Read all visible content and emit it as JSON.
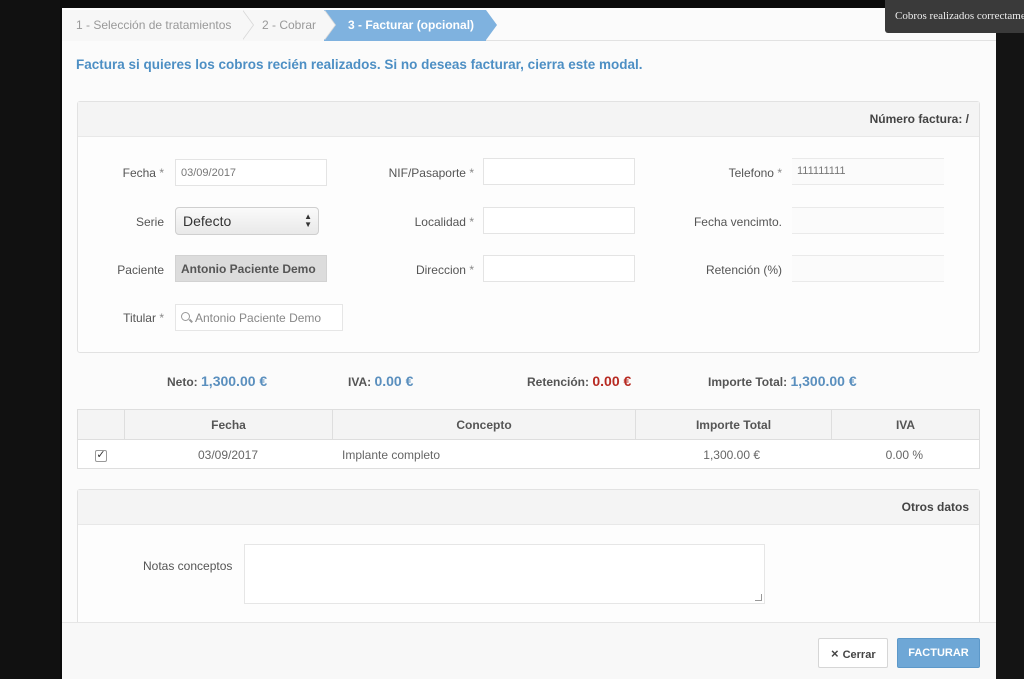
{
  "wizard": {
    "steps": [
      {
        "label": "1 - Selección de tratamientos"
      },
      {
        "label": "2 - Cobrar"
      },
      {
        "label": "3 - Facturar (opcional)"
      }
    ]
  },
  "toast": {
    "text": "Cobros realizados correctamente"
  },
  "intro": "Factura si quieres los cobros recién realizados. Si no deseas facturar, cierra este modal.",
  "invoice": {
    "header": "Número factura: /",
    "fields": {
      "fecha": {
        "label": "Fecha",
        "value": "03/09/2017"
      },
      "serie": {
        "label": "Serie",
        "value": "Defecto"
      },
      "paciente": {
        "label": "Paciente",
        "value": "Antonio Paciente Demo"
      },
      "titular": {
        "label": "Titular",
        "placeholder": "Antonio Paciente Demo"
      },
      "nif": {
        "label": "NIF/Pasaporte",
        "value": ""
      },
      "localidad": {
        "label": "Localidad",
        "value": ""
      },
      "direccion": {
        "label": "Direccion",
        "value": ""
      },
      "telefono": {
        "label": "Telefono",
        "value": "111111111"
      },
      "vencimiento": {
        "label": "Fecha vencimto.",
        "value": ""
      },
      "retencion": {
        "label": "Retención (%)",
        "value": ""
      }
    },
    "required_mark": "*"
  },
  "totals": {
    "neto": {
      "label": "Neto:",
      "value": "1,300.00 €"
    },
    "iva": {
      "label": "IVA:",
      "value": "0.00 €"
    },
    "retencion": {
      "label": "Retención:",
      "value": "0.00 €"
    },
    "importe_total": {
      "label": "Importe Total:",
      "value": "1,300.00 €"
    },
    "colors": {
      "value": "#5a8fbe",
      "retencion": "#b72a22"
    }
  },
  "table": {
    "columns": [
      "Fecha",
      "Concepto",
      "Importe Total",
      "IVA"
    ],
    "rows": [
      {
        "checked": true,
        "check_glyph": "✓",
        "fecha": "03/09/2017",
        "concepto": "Implante completo",
        "importe": "1,300.00 €",
        "iva": "0.00 %"
      }
    ]
  },
  "other": {
    "header": "Otros datos",
    "notes_label": "Notas conceptos",
    "notes_value": ""
  },
  "footer": {
    "close_icon": "×",
    "close_label": "Cerrar",
    "submit_label": "FACTURAR"
  },
  "accent": "#7fb2df"
}
